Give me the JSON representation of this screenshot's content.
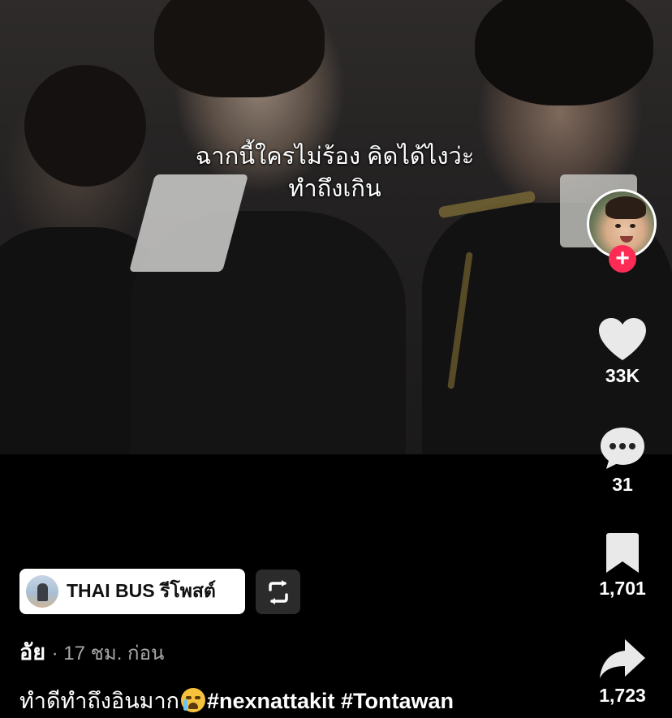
{
  "video": {
    "subtitle_line1": "ฉากนี้ใครไม่ร้อง คิดได้ไงว่ะ",
    "subtitle_line2": "ทำถึงเกิน"
  },
  "rail": {
    "follow_symbol": "+",
    "like_count": "33K",
    "comment_count": "31",
    "bookmark_count": "1,701",
    "share_count": "1,723",
    "icons": [
      "heart-icon",
      "comment-icon",
      "bookmark-icon",
      "share-icon"
    ]
  },
  "repost": {
    "label": "THAI BUS รีโพสต์"
  },
  "post": {
    "author": "อัย",
    "meta": "· 17 ชม. ก่อน",
    "caption_text": "ทำดีทำถึงอินมาก",
    "hashtags": "#nexnattakit #Tontawan"
  },
  "colors": {
    "accent_follow": "#fe2c55",
    "background": "#000000",
    "meta_gray": "#a8a8a8"
  }
}
